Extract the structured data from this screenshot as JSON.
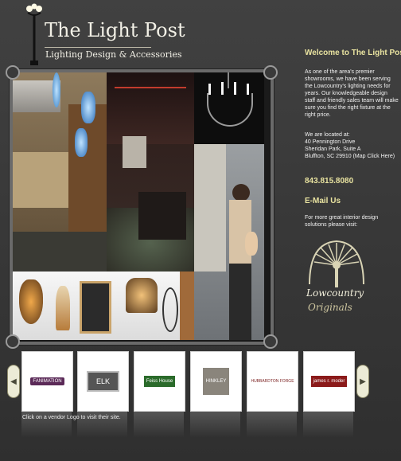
{
  "logo": {
    "title": "The Light Post",
    "subtitle": "Lighting Design & Accessories"
  },
  "side": {
    "welcome": "Welcome to The Light Post!!",
    "intro": "As one of the area's premier showrooms, we have been serving the Lowcountry's lighting needs for years. Our knowledgeable design staff and friendly sales team will make sure you find the right fixture at the right price.",
    "located_label": "We are located at:",
    "address_line1": "40 Pennington Drive",
    "address_line2": "Sheridan Park, Suite A",
    "address_line3": "Bluffton, SC 29910 (Map Click Here)",
    "phone": "843.815.8080",
    "email_label": "E-Mail Us",
    "more_text": "For more great interior design solutions please visit:",
    "partner_logo_line1": "Lowcountry",
    "partner_logo_line2": "Originals"
  },
  "vendors": {
    "caption": "Click on a vendor Logo to visit their site.",
    "items": [
      {
        "label": "FANIMATION",
        "color": "#5b2a58"
      },
      {
        "label": "ELK",
        "color": "#555555"
      },
      {
        "label": "Feiss House",
        "color": "#2b6b2b"
      },
      {
        "label": "HINKLEY",
        "color": "#6b6b6b"
      },
      {
        "label": "HUBBARDTON FORGE",
        "color": "#7a1f1f"
      },
      {
        "label": "james r. moder",
        "color": "#8b1a1a"
      }
    ],
    "prev_icon": "chevron-left-icon",
    "next_icon": "chevron-right-icon"
  },
  "colors": {
    "accent": "#e9e3a0",
    "background": "#3c3c3c"
  }
}
